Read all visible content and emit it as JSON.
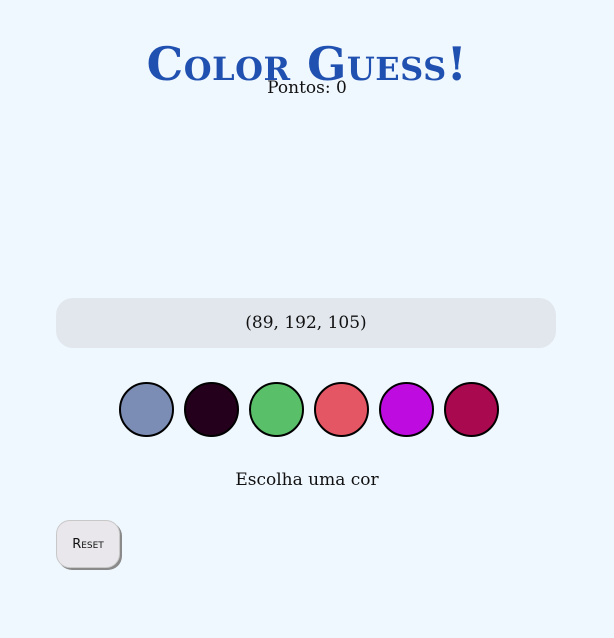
{
  "header": {
    "title": "Color Guess!"
  },
  "score": {
    "label": "Pontos:",
    "value": "0"
  },
  "target": {
    "rgb_text": "(89, 192, 105)"
  },
  "options": [
    {
      "name": "color-option-1",
      "color": "#7b8db4"
    },
    {
      "name": "color-option-2",
      "color": "#25001c"
    },
    {
      "name": "color-option-3",
      "color": "#59c069"
    },
    {
      "name": "color-option-4",
      "color": "#e55664"
    },
    {
      "name": "color-option-5",
      "color": "#be0ce0"
    },
    {
      "name": "color-option-6",
      "color": "#a9094e"
    }
  ],
  "status": {
    "message": "Escolha uma cor"
  },
  "controls": {
    "reset_label": "Reset"
  },
  "colors": {
    "background": "#f0f8ff",
    "title": "#2151b0",
    "rgb_box": "#e1e7ed"
  }
}
